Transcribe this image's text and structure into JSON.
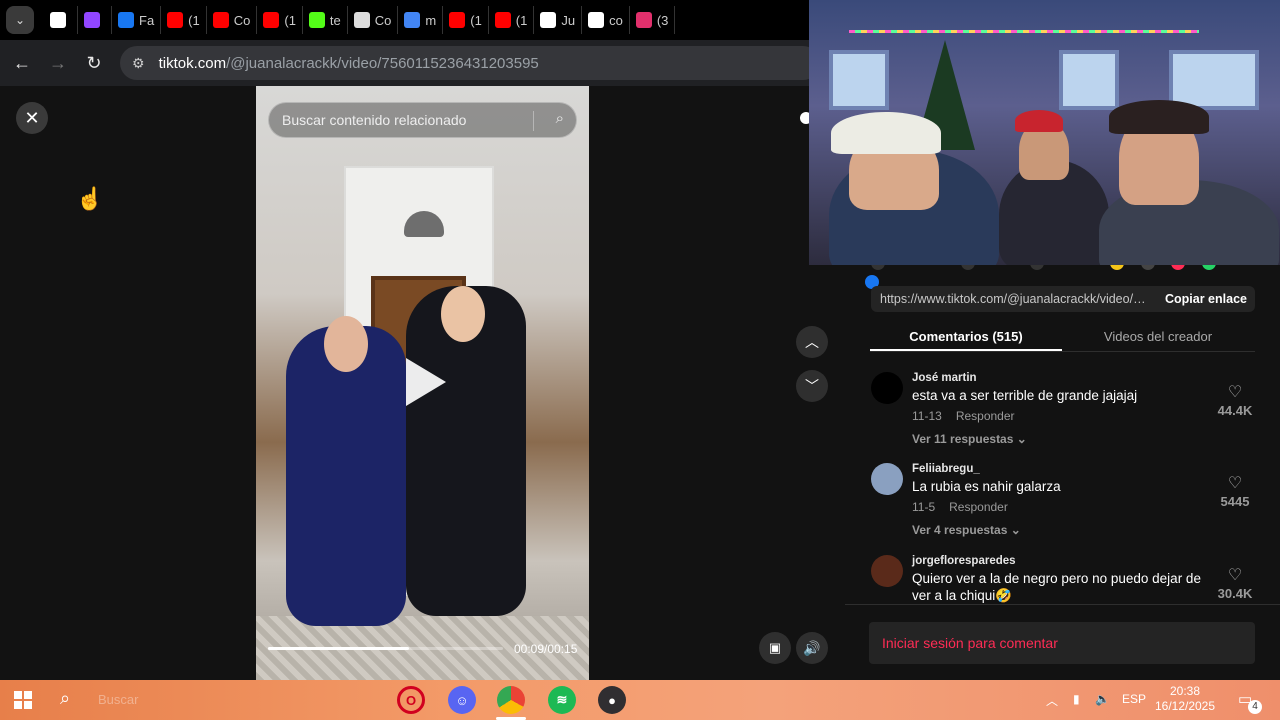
{
  "browser": {
    "tabs": [
      {
        "icon": "threads-icon",
        "label": "",
        "color": "#ffffff"
      },
      {
        "icon": "twitch-icon",
        "label": "",
        "color": "#9146ff"
      },
      {
        "icon": "facebook-icon",
        "label": "Fa",
        "color": "#1877f2"
      },
      {
        "icon": "youtube-icon",
        "label": "(1",
        "color": "#ff0000"
      },
      {
        "icon": "youtube-icon",
        "label": "Co",
        "color": "#ff0000"
      },
      {
        "icon": "youtube-icon",
        "label": "(1",
        "color": "#ff0000"
      },
      {
        "icon": "kick-icon",
        "label": "te",
        "color": "#53fc18"
      },
      {
        "icon": "chatgpt-icon",
        "label": "Co",
        "color": "#dddddd"
      },
      {
        "icon": "google-icon",
        "label": "m",
        "color": "#4285f4"
      },
      {
        "icon": "youtube-icon",
        "label": "(1",
        "color": "#ff0000"
      },
      {
        "icon": "youtube-icon",
        "label": "(1",
        "color": "#ff0000"
      },
      {
        "icon": "tiktok-icon",
        "label": "Ju",
        "color": "#ffffff"
      },
      {
        "icon": "tiktok-icon",
        "label": "co",
        "color": "#ffffff"
      },
      {
        "icon": "instagram-icon",
        "label": "(3",
        "color": "#e1306c"
      }
    ],
    "url_host": "tiktok.com",
    "url_path": "/@juanalacrackk/video/7560115236431203595"
  },
  "video": {
    "search_placeholder": "Buscar contenido relacionado",
    "time": "00:09/00:15",
    "progress_fraction": 0.6
  },
  "panel": {
    "share_link": "https://www.tiktok.com/@juanalacrackk/video/756...",
    "copy_label": "Copiar enlace",
    "tab_comments": "Comentarios (515)",
    "tab_creator": "Videos del creador",
    "comments": [
      {
        "user": "José martin",
        "text": "esta va a ser terrible de grande jajajaj",
        "date": "11-13",
        "reply": "Responder",
        "replies": "Ver 11 respuestas ⌄",
        "likes": "44.4K",
        "avatar_color": "#000000"
      },
      {
        "user": "Feliiabregu_",
        "text": "La rubia es nahir galarza",
        "date": "11-5",
        "reply": "Responder",
        "replies": "Ver 4 respuestas ⌄",
        "likes": "5445",
        "avatar_color": "#8aa0c0"
      },
      {
        "user": "jorgefloresparedes",
        "text": "Quiero ver a la de negro pero no puedo dejar de ver a la chiqui🤣",
        "likes": "30.4K",
        "avatar_color": "#5a2a1a"
      }
    ],
    "login_prompt": "Iniciar sesión para comentar"
  },
  "taskbar": {
    "search_text": "Buscar",
    "lang": "ESP",
    "time": "20:38",
    "date": "16/12/2025",
    "notifications": "4"
  },
  "colors": {
    "tiktok_red": "#fe2c55",
    "taskbar": "#f39a68"
  }
}
